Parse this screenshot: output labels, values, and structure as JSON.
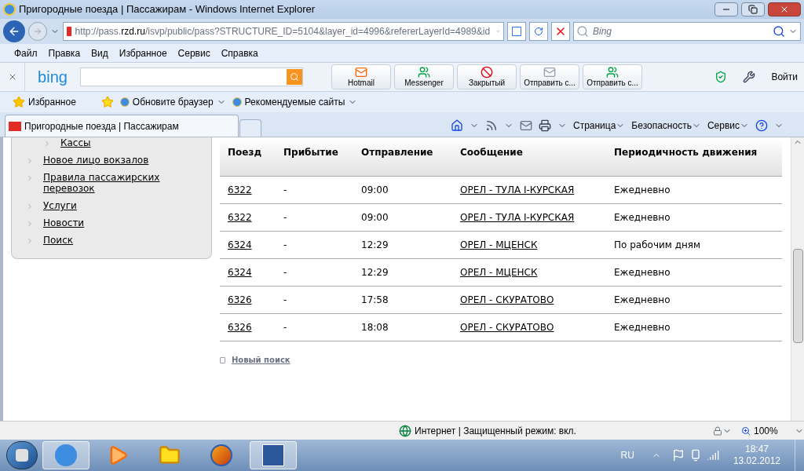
{
  "window": {
    "title": "Пригородные поезда | Пассажирам - Windows Internet Explorer"
  },
  "address_bar": {
    "url_prefix": "http://pass.",
    "url_domain": "rzd.ru",
    "url_rest": "/isvp/public/pass?STRUCTURE_ID=5104&layer_id=4996&refererLayerId=4989&id",
    "search_placeholder": "Bing"
  },
  "menu_bar": [
    "Файл",
    "Правка",
    "Вид",
    "Избранное",
    "Сервис",
    "Справка"
  ],
  "bing_bar": {
    "logo": "bing",
    "buttons": [
      {
        "label": "Hotmail",
        "kind": "mail"
      },
      {
        "label": "Messenger",
        "kind": "people"
      },
      {
        "label": "Закрытый",
        "kind": "block"
      },
      {
        "label": "Отправить с...",
        "kind": "envelope"
      },
      {
        "label": "Отправить с...",
        "kind": "people"
      }
    ],
    "sign_in": "Войти"
  },
  "favorites_bar": {
    "favorites": "Избранное",
    "links": [
      "Обновите браузер",
      "Рекомендуемые сайты"
    ]
  },
  "tabs": [
    {
      "label": "Пригородные поезда | Пассажирам",
      "selected": true
    }
  ],
  "command_bar": [
    "Страница",
    "Безопасность",
    "Сервис"
  ],
  "sidebar": {
    "items": [
      {
        "label": "Кассы",
        "kind": "subitem"
      },
      {
        "label": "Новое лицо вокзалов",
        "kind": "item"
      },
      {
        "label": "Правила пассажирских перевозок",
        "kind": "item"
      },
      {
        "label": "Услуги",
        "kind": "item"
      },
      {
        "label": "Новости",
        "kind": "item"
      },
      {
        "label": "Поиск",
        "kind": "item"
      }
    ]
  },
  "table": {
    "columns": [
      "Поезд",
      "Прибытие",
      "Отправление",
      "Сообщение",
      "Периодичность движения"
    ],
    "rows": [
      {
        "train": "6322",
        "arrival": "-",
        "departure": "09:00",
        "route": "ОРЕЛ - ТУЛА I-КУРСКАЯ",
        "schedule": "Ежедневно"
      },
      {
        "train": "6322",
        "arrival": "-",
        "departure": "09:00",
        "route": "ОРЕЛ - ТУЛА I-КУРСКАЯ",
        "schedule": "Ежедневно"
      },
      {
        "train": "6324",
        "arrival": "-",
        "departure": "12:29",
        "route": "ОРЕЛ - МЦЕНСК",
        "schedule": "По рабочим дням"
      },
      {
        "train": "6324",
        "arrival": "-",
        "departure": "12:29",
        "route": "ОРЕЛ - МЦЕНСК",
        "schedule": "Ежедневно"
      },
      {
        "train": "6326",
        "arrival": "-",
        "departure": "17:58",
        "route": "ОРЕЛ - СКУРАТОВО",
        "schedule": "Ежедневно"
      },
      {
        "train": "6326",
        "arrival": "-",
        "departure": "18:08",
        "route": "ОРЕЛ - СКУРАТОВО",
        "schedule": "Ежедневно"
      }
    ]
  },
  "new_search": "Новый поиск",
  "status_bar": {
    "zone": "Интернет | Защищенный режим: вкл.",
    "zoom": "100%"
  },
  "taskbar": {
    "apps": [
      {
        "kind": "ie",
        "active": true
      },
      {
        "kind": "media",
        "active": false
      },
      {
        "kind": "folder",
        "active": false
      },
      {
        "kind": "firefox",
        "active": false
      },
      {
        "kind": "word",
        "active": true
      }
    ],
    "language": "RU",
    "time": "18:47",
    "date": "13.02.2012"
  }
}
